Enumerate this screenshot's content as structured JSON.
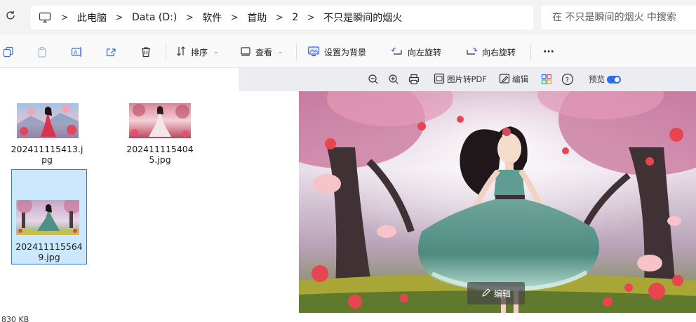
{
  "address_bar": {
    "refresh_icon": "refresh-icon",
    "pc_icon": "computer-icon",
    "breadcrumbs": [
      "此电脑",
      "Data (D:)",
      "软件",
      "首助",
      "2",
      "不只是瞬间的烟火"
    ],
    "separator": ">",
    "search_placeholder": "在 不只是瞬间的烟火 中搜索"
  },
  "toolbar": {
    "sort_label": "排序",
    "view_label": "查看",
    "set_background_label": "设置为背景",
    "rotate_left_label": "向左旋转",
    "rotate_right_label": "向右旋转",
    "more_label": "···"
  },
  "files": [
    {
      "name": "202411115413.jpg",
      "name_line1": "202411115413.j",
      "name_line2": "pg",
      "selected": false
    },
    {
      "name": "2024111154045.jpg",
      "name_line1": "202411115404",
      "name_line2": "5.jpg",
      "selected": false
    },
    {
      "name": "2024111155649.jpg",
      "name_line1": "202411115564",
      "name_line2": "9.jpg",
      "selected": true
    }
  ],
  "status_bar": {
    "size_text": "830 KB"
  },
  "preview": {
    "toolbar": {
      "zoom_out_icon": "zoom-out-icon",
      "zoom_in_icon": "zoom-in-icon",
      "print_icon": "print-icon",
      "image_to_pdf_label": "图片转PDF",
      "edit_label": "编辑",
      "help_icon": "help-icon",
      "preview_label": "预览",
      "preview_toggle_on": true
    },
    "overlay_edit_label": "编辑"
  },
  "colors": {
    "accent": "#2b6de8",
    "selection_bg": "#cce8ff",
    "selection_border": "#3a77c3",
    "preview_toolbar_bg": "#ebedf1"
  }
}
